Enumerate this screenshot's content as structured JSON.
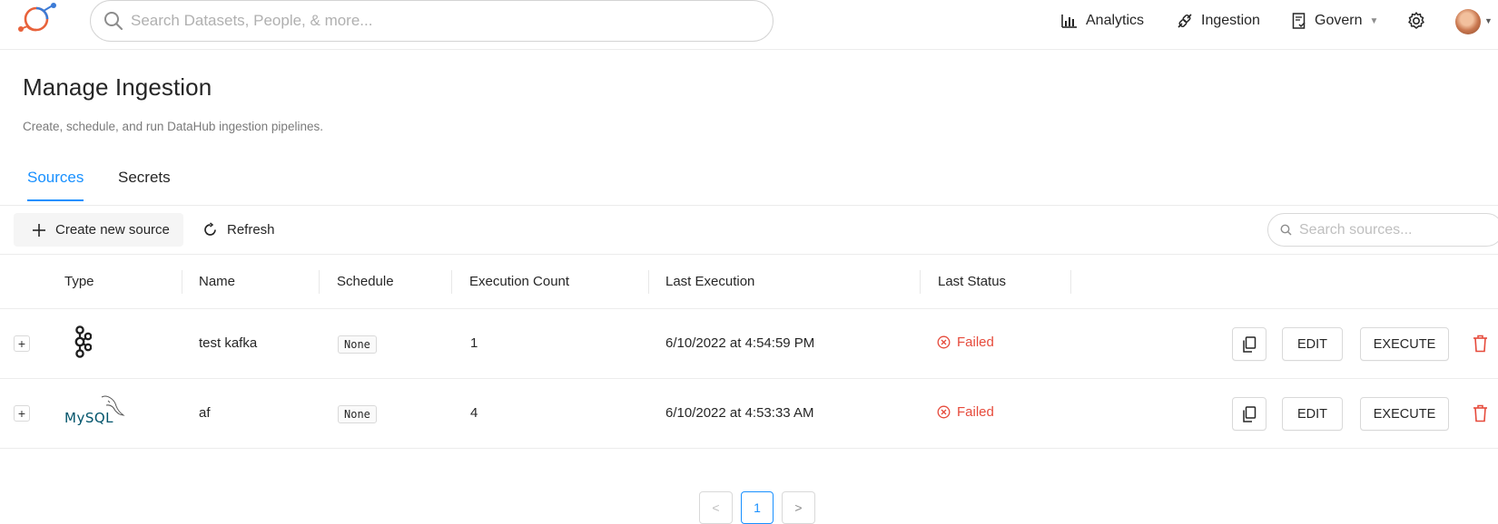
{
  "header": {
    "search_placeholder": "Search Datasets, People, & more...",
    "nav": {
      "analytics": "Analytics",
      "ingestion": "Ingestion",
      "govern": "Govern"
    },
    "icons": {
      "logo": "datahub-logo-icon",
      "search": "search-icon",
      "analytics": "bar-chart-icon",
      "ingestion": "api-plug-icon",
      "govern": "document-check-icon",
      "settings": "gear-icon",
      "avatar": "user-avatar"
    }
  },
  "page": {
    "title": "Manage Ingestion",
    "subtitle": "Create, schedule, and run DataHub ingestion pipelines."
  },
  "tabs": [
    {
      "label": "Sources",
      "active": true
    },
    {
      "label": "Secrets",
      "active": false
    }
  ],
  "toolbar": {
    "create_label": "Create new source",
    "refresh_label": "Refresh",
    "search_placeholder": "Search sources..."
  },
  "table": {
    "columns": [
      "Type",
      "Name",
      "Schedule",
      "Execution Count",
      "Last Execution",
      "Last Status"
    ],
    "rows": [
      {
        "expand": "+",
        "type_icon": "kafka-icon",
        "name": "test kafka",
        "schedule": "None",
        "execution_count": "1",
        "last_execution": "6/10/2022 at 4:54:59 PM",
        "last_status": "Failed",
        "edit_label": "EDIT",
        "execute_label": "EXECUTE"
      },
      {
        "expand": "+",
        "type_icon": "mysql-icon",
        "type_text": "MySQL",
        "name": "af",
        "schedule": "None",
        "execution_count": "4",
        "last_execution": "6/10/2022 at 4:53:33 AM",
        "last_status": "Failed",
        "edit_label": "EDIT",
        "execute_label": "EXECUTE"
      }
    ]
  },
  "pagination": {
    "prev": "<",
    "current_page": "1",
    "next": ">"
  },
  "colors": {
    "accent": "#1890ff",
    "failed": "#e64a3b",
    "delete": "#e64a3b"
  }
}
